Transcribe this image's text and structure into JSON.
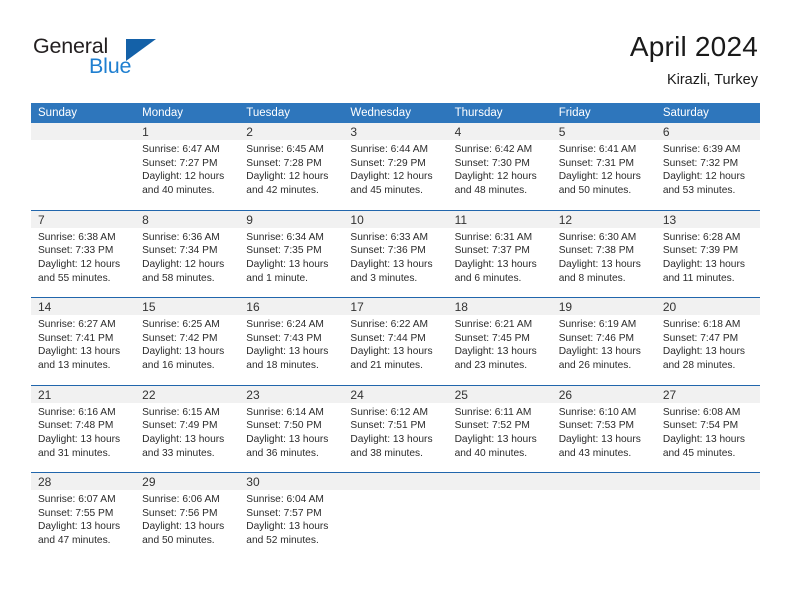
{
  "brand": {
    "name_part1": "General",
    "name_part2": "Blue",
    "accent_color": "#1f7fd0",
    "triangle_color": "#1461a8"
  },
  "header": {
    "title": "April 2024",
    "subtitle": "Kirazli, Turkey"
  },
  "calendar": {
    "header_bg": "#2e76bc",
    "daynum_bg": "#f1f1f1",
    "week_separator_color": "#2166ac",
    "weekdays": [
      "Sunday",
      "Monday",
      "Tuesday",
      "Wednesday",
      "Thursday",
      "Friday",
      "Saturday"
    ],
    "weeks": [
      {
        "days": [
          {
            "num": "",
            "sunrise": "",
            "sunset": "",
            "daylight1": "",
            "daylight2": ""
          },
          {
            "num": "1",
            "sunrise": "Sunrise: 6:47 AM",
            "sunset": "Sunset: 7:27 PM",
            "daylight1": "Daylight: 12 hours",
            "daylight2": "and 40 minutes."
          },
          {
            "num": "2",
            "sunrise": "Sunrise: 6:45 AM",
            "sunset": "Sunset: 7:28 PM",
            "daylight1": "Daylight: 12 hours",
            "daylight2": "and 42 minutes."
          },
          {
            "num": "3",
            "sunrise": "Sunrise: 6:44 AM",
            "sunset": "Sunset: 7:29 PM",
            "daylight1": "Daylight: 12 hours",
            "daylight2": "and 45 minutes."
          },
          {
            "num": "4",
            "sunrise": "Sunrise: 6:42 AM",
            "sunset": "Sunset: 7:30 PM",
            "daylight1": "Daylight: 12 hours",
            "daylight2": "and 48 minutes."
          },
          {
            "num": "5",
            "sunrise": "Sunrise: 6:41 AM",
            "sunset": "Sunset: 7:31 PM",
            "daylight1": "Daylight: 12 hours",
            "daylight2": "and 50 minutes."
          },
          {
            "num": "6",
            "sunrise": "Sunrise: 6:39 AM",
            "sunset": "Sunset: 7:32 PM",
            "daylight1": "Daylight: 12 hours",
            "daylight2": "and 53 minutes."
          }
        ]
      },
      {
        "days": [
          {
            "num": "7",
            "sunrise": "Sunrise: 6:38 AM",
            "sunset": "Sunset: 7:33 PM",
            "daylight1": "Daylight: 12 hours",
            "daylight2": "and 55 minutes."
          },
          {
            "num": "8",
            "sunrise": "Sunrise: 6:36 AM",
            "sunset": "Sunset: 7:34 PM",
            "daylight1": "Daylight: 12 hours",
            "daylight2": "and 58 minutes."
          },
          {
            "num": "9",
            "sunrise": "Sunrise: 6:34 AM",
            "sunset": "Sunset: 7:35 PM",
            "daylight1": "Daylight: 13 hours",
            "daylight2": "and 1 minute."
          },
          {
            "num": "10",
            "sunrise": "Sunrise: 6:33 AM",
            "sunset": "Sunset: 7:36 PM",
            "daylight1": "Daylight: 13 hours",
            "daylight2": "and 3 minutes."
          },
          {
            "num": "11",
            "sunrise": "Sunrise: 6:31 AM",
            "sunset": "Sunset: 7:37 PM",
            "daylight1": "Daylight: 13 hours",
            "daylight2": "and 6 minutes."
          },
          {
            "num": "12",
            "sunrise": "Sunrise: 6:30 AM",
            "sunset": "Sunset: 7:38 PM",
            "daylight1": "Daylight: 13 hours",
            "daylight2": "and 8 minutes."
          },
          {
            "num": "13",
            "sunrise": "Sunrise: 6:28 AM",
            "sunset": "Sunset: 7:39 PM",
            "daylight1": "Daylight: 13 hours",
            "daylight2": "and 11 minutes."
          }
        ]
      },
      {
        "days": [
          {
            "num": "14",
            "sunrise": "Sunrise: 6:27 AM",
            "sunset": "Sunset: 7:41 PM",
            "daylight1": "Daylight: 13 hours",
            "daylight2": "and 13 minutes."
          },
          {
            "num": "15",
            "sunrise": "Sunrise: 6:25 AM",
            "sunset": "Sunset: 7:42 PM",
            "daylight1": "Daylight: 13 hours",
            "daylight2": "and 16 minutes."
          },
          {
            "num": "16",
            "sunrise": "Sunrise: 6:24 AM",
            "sunset": "Sunset: 7:43 PM",
            "daylight1": "Daylight: 13 hours",
            "daylight2": "and 18 minutes."
          },
          {
            "num": "17",
            "sunrise": "Sunrise: 6:22 AM",
            "sunset": "Sunset: 7:44 PM",
            "daylight1": "Daylight: 13 hours",
            "daylight2": "and 21 minutes."
          },
          {
            "num": "18",
            "sunrise": "Sunrise: 6:21 AM",
            "sunset": "Sunset: 7:45 PM",
            "daylight1": "Daylight: 13 hours",
            "daylight2": "and 23 minutes."
          },
          {
            "num": "19",
            "sunrise": "Sunrise: 6:19 AM",
            "sunset": "Sunset: 7:46 PM",
            "daylight1": "Daylight: 13 hours",
            "daylight2": "and 26 minutes."
          },
          {
            "num": "20",
            "sunrise": "Sunrise: 6:18 AM",
            "sunset": "Sunset: 7:47 PM",
            "daylight1": "Daylight: 13 hours",
            "daylight2": "and 28 minutes."
          }
        ]
      },
      {
        "days": [
          {
            "num": "21",
            "sunrise": "Sunrise: 6:16 AM",
            "sunset": "Sunset: 7:48 PM",
            "daylight1": "Daylight: 13 hours",
            "daylight2": "and 31 minutes."
          },
          {
            "num": "22",
            "sunrise": "Sunrise: 6:15 AM",
            "sunset": "Sunset: 7:49 PM",
            "daylight1": "Daylight: 13 hours",
            "daylight2": "and 33 minutes."
          },
          {
            "num": "23",
            "sunrise": "Sunrise: 6:14 AM",
            "sunset": "Sunset: 7:50 PM",
            "daylight1": "Daylight: 13 hours",
            "daylight2": "and 36 minutes."
          },
          {
            "num": "24",
            "sunrise": "Sunrise: 6:12 AM",
            "sunset": "Sunset: 7:51 PM",
            "daylight1": "Daylight: 13 hours",
            "daylight2": "and 38 minutes."
          },
          {
            "num": "25",
            "sunrise": "Sunrise: 6:11 AM",
            "sunset": "Sunset: 7:52 PM",
            "daylight1": "Daylight: 13 hours",
            "daylight2": "and 40 minutes."
          },
          {
            "num": "26",
            "sunrise": "Sunrise: 6:10 AM",
            "sunset": "Sunset: 7:53 PM",
            "daylight1": "Daylight: 13 hours",
            "daylight2": "and 43 minutes."
          },
          {
            "num": "27",
            "sunrise": "Sunrise: 6:08 AM",
            "sunset": "Sunset: 7:54 PM",
            "daylight1": "Daylight: 13 hours",
            "daylight2": "and 45 minutes."
          }
        ]
      },
      {
        "days": [
          {
            "num": "28",
            "sunrise": "Sunrise: 6:07 AM",
            "sunset": "Sunset: 7:55 PM",
            "daylight1": "Daylight: 13 hours",
            "daylight2": "and 47 minutes."
          },
          {
            "num": "29",
            "sunrise": "Sunrise: 6:06 AM",
            "sunset": "Sunset: 7:56 PM",
            "daylight1": "Daylight: 13 hours",
            "daylight2": "and 50 minutes."
          },
          {
            "num": "30",
            "sunrise": "Sunrise: 6:04 AM",
            "sunset": "Sunset: 7:57 PM",
            "daylight1": "Daylight: 13 hours",
            "daylight2": "and 52 minutes."
          },
          {
            "num": "",
            "sunrise": "",
            "sunset": "",
            "daylight1": "",
            "daylight2": ""
          },
          {
            "num": "",
            "sunrise": "",
            "sunset": "",
            "daylight1": "",
            "daylight2": ""
          },
          {
            "num": "",
            "sunrise": "",
            "sunset": "",
            "daylight1": "",
            "daylight2": ""
          },
          {
            "num": "",
            "sunrise": "",
            "sunset": "",
            "daylight1": "",
            "daylight2": ""
          }
        ]
      }
    ]
  }
}
